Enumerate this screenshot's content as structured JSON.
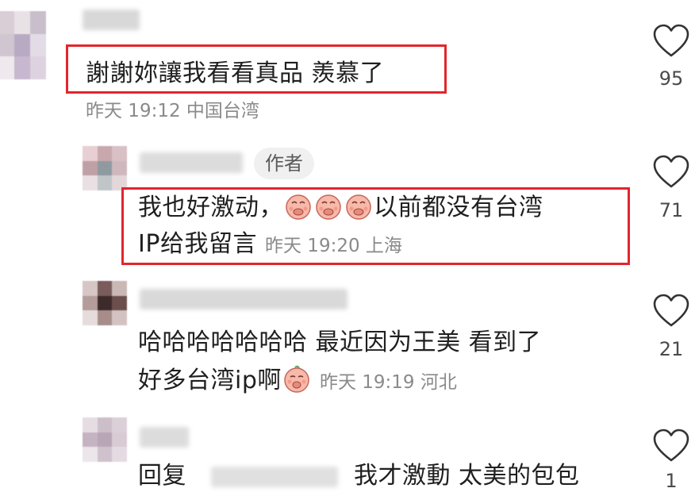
{
  "comments": [
    {
      "text": "謝謝妳讓我看看真品 羨慕了",
      "meta": "昨天 19:12 中国台湾",
      "likes": "95"
    },
    {
      "author_badge": "作者",
      "text_line1": "我也好激动，",
      "text_line1b": "以前都没有台湾",
      "text_line2": "IP给我留言",
      "meta": "昨天 19:20 上海",
      "likes": "71"
    },
    {
      "text_line1": "哈哈哈哈哈哈哈 最近因为王美 看到了",
      "text_line2": "好多台湾ip啊",
      "meta": "昨天 19:19 河北",
      "likes": "21"
    },
    {
      "reply_prefix": "回复",
      "text": "我才激動 太美的包包",
      "likes": "1"
    }
  ],
  "colors": {
    "highlight": "#e2262c",
    "meta": "#8a8a8a",
    "badge_bg": "#f0f0f0"
  },
  "icons": {
    "like": "heart-outline-icon",
    "emoji": "shy-peach-emoji"
  }
}
